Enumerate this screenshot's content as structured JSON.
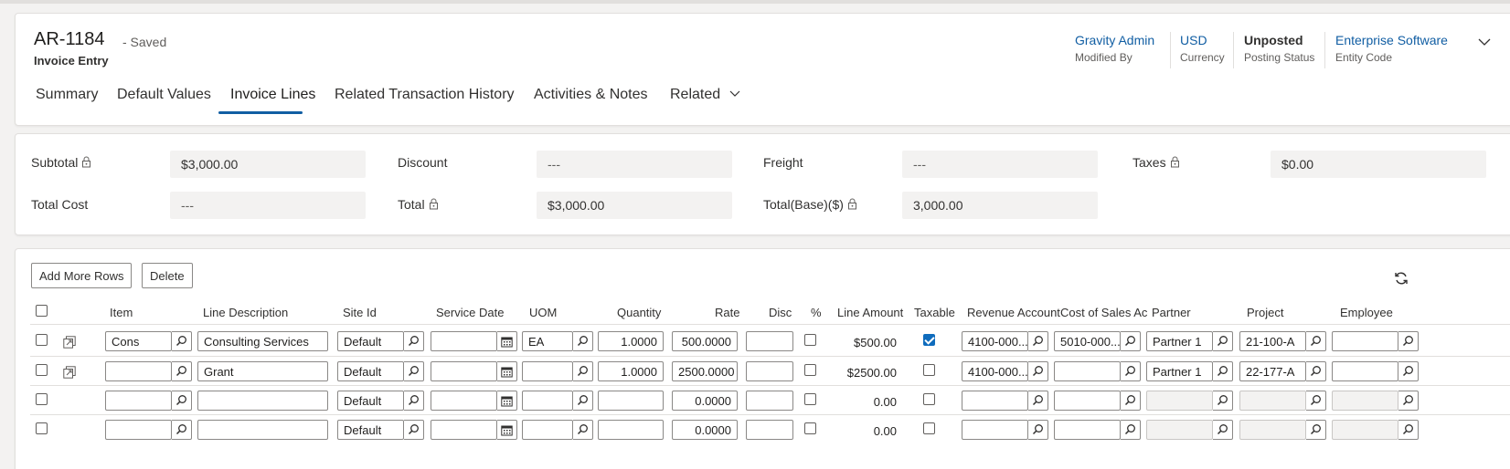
{
  "record": {
    "title": "AR-1184",
    "saved_status": "- Saved",
    "form_name": "Invoice Entry"
  },
  "header_fields": [
    {
      "value": "Gravity Admin",
      "label": "Modified By"
    },
    {
      "value": "USD",
      "label": "Currency"
    },
    {
      "value": "Unposted",
      "label": "Posting Status"
    },
    {
      "value": "Enterprise Software",
      "label": "Entity Code"
    }
  ],
  "tabs": [
    {
      "label": "Summary"
    },
    {
      "label": "Default Values"
    },
    {
      "label": "Invoice Lines",
      "active": true
    },
    {
      "label": "Related Transaction History"
    },
    {
      "label": "Activities & Notes"
    },
    {
      "label": "Related"
    }
  ],
  "totals": {
    "subtotal": {
      "label": "Subtotal",
      "value": "$3,000.00"
    },
    "discount": {
      "label": "Discount",
      "value": "---"
    },
    "freight": {
      "label": "Freight",
      "value": "---"
    },
    "taxes": {
      "label": "Taxes",
      "value": "$0.00"
    },
    "total_cost": {
      "label": "Total Cost",
      "value": "---"
    },
    "total": {
      "label": "Total",
      "value": "$3,000.00"
    },
    "total_base": {
      "label": "Total(Base)($)",
      "value": "3,000.00"
    }
  },
  "toolbar": {
    "add_rows_label": "Add More Rows",
    "delete_label": "Delete"
  },
  "columns": {
    "item": "Item",
    "line_description": "Line Description",
    "site_id": "Site Id",
    "service_date": "Service Date",
    "uom": "UOM",
    "quantity": "Quantity",
    "rate": "Rate",
    "disc": "Disc",
    "pct": "%",
    "line_amount": "Line Amount",
    "taxable": "Taxable",
    "revenue_account": "Revenue Account",
    "cost_of_sales": "Cost of Sales Accc",
    "partner": "Partner",
    "project": "Project",
    "employee": "Employee"
  },
  "rows": [
    {
      "item": "Cons",
      "line_description": "Consulting Services",
      "site_id": "Default",
      "service_date": "",
      "uom": "EA",
      "quantity": "1.0000",
      "rate": "500.0000",
      "disc": "",
      "pct": false,
      "line_amount": "$500.00",
      "taxable": true,
      "revenue_account": "4100-000...",
      "cost_of_sales": "5010-000...",
      "partner": "Partner 1",
      "project": "21-100-A",
      "employee": ""
    },
    {
      "item": "",
      "line_description": "Grant",
      "site_id": "Default",
      "service_date": "",
      "uom": "",
      "quantity": "1.0000",
      "rate": "2500.0000",
      "disc": "",
      "pct": false,
      "line_amount": "$2500.00",
      "taxable": false,
      "revenue_account": "4100-000...",
      "cost_of_sales": "",
      "partner": "Partner 1",
      "project": "22-177-A",
      "employee": ""
    },
    {
      "item": "",
      "line_description": "",
      "site_id": "Default",
      "service_date": "",
      "uom": "",
      "quantity": "",
      "rate": "0.0000",
      "disc": "",
      "pct": false,
      "line_amount": "0.00",
      "taxable": false,
      "revenue_account": "",
      "cost_of_sales": "",
      "partner": "",
      "project": "",
      "employee": ""
    },
    {
      "item": "",
      "line_description": "",
      "site_id": "Default",
      "service_date": "",
      "uom": "",
      "quantity": "",
      "rate": "0.0000",
      "disc": "",
      "pct": false,
      "line_amount": "0.00",
      "taxable": false,
      "revenue_account": "",
      "cost_of_sales": "",
      "partner": "",
      "project": "",
      "employee": ""
    }
  ],
  "icons": {
    "lock": "lock-icon",
    "lookup": "search-icon",
    "calendar": "calendar-icon",
    "open_record": "open-record-icon",
    "refresh": "refresh-icon",
    "chevron": "chevron-down-icon"
  },
  "colors": {
    "accent": "#115ea3",
    "checkbox_checked": "#0f6cbd",
    "field_bg": "#f3f2f1"
  }
}
